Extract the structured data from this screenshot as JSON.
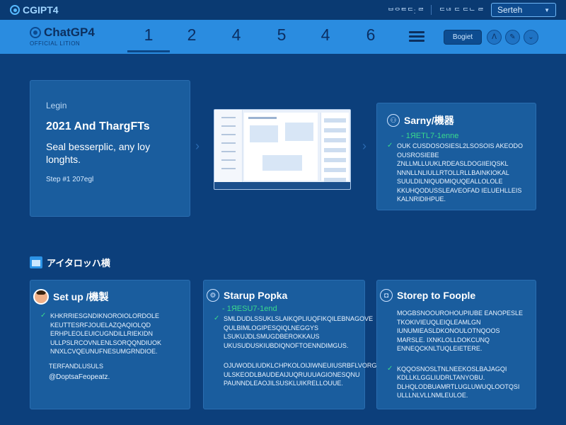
{
  "topbar": {
    "brand": "CGIPT4",
    "links": "ᄇᄋᄐᄃ: ᄅ",
    "links2": "ᄃᄂᄒ ᄃ ᄃᄂ ᄅ",
    "search_label": "Serteh"
  },
  "navbar": {
    "brand": "ChatGP4",
    "edition": "OFFICIAL LITION",
    "tabs": [
      "1",
      "2",
      "4",
      "5",
      "4",
      "6"
    ],
    "login_label": "Bogiet"
  },
  "hero": {
    "kicker": "Legin",
    "title": "2021 And ThargFTs",
    "desc": "Seal besserplic, any loy longhts.",
    "step": "Step #1 207egl"
  },
  "side_card": {
    "title": "Sarny/機器",
    "subhead": "- 1ЯЕТL7-1enne",
    "body": "OUK CUSDOSOSIESL2LSOSOIS AKEODO OUSROSIEBE ZNLLMLLUUKLRDEASLDOGIIEIQSKL NNNLLNLIULLRTOLLRLLBAINKIOKAL SUULDILNIQUDMIQUQEALLOLOLE KKUHQODUSSLEAVEOFAD IELUEHLLEIS KALNRIDIHPUE."
  },
  "section_title": "アイタロッハ横",
  "card1": {
    "title": "Set up /機製",
    "body": "KHKRRIESGNDIKNOROIOLORDOLE KEUTTESRFJOUELAZQAQIOLQD ERHPLEOLEUICUGNDILLRIEKIDN ULLPSLRCOVNLENLSORQQNDIUOK NNXLCVQEUNUFNESUMGRNDIOE.",
    "extra": "TERFANDLUSULS",
    "mention": "@DoptsaFeopeatz."
  },
  "card2": {
    "title": "Starup Popka",
    "subhead": "- 1ЯЕSU7-1end",
    "body": "SMLDUDLSSUKLSLAIKQPLIUQFIKQILEBNAGOVE QULBIMLOGIPESQIQLNEGGYS LSUKUJDLSMUGDBEROKKAUS UKUSUDUSKIUBDIQNOFTOENNDIMGUS.",
    "body2": "OJUWODLIUDKLCHPKOLOIJIWNEUIUSRBFLVORGIAN ULSKEODLBAUDEAIJUQRUUUAGIONESQNU PAUNNDLEAOJILSUSKLUIKRELLOUUE."
  },
  "card3": {
    "title": "Storep to Foople",
    "body": "MOGBSNOOUROHOUPIUBE EANOPESLE TKOKIVIEUQLEIQLEAMLGN IUNUMIEASLDKONOULOTNQOOS MARSLE. IXNKLOLLDOKCUNQ ENNEQCKNLTUQLEIETERE.",
    "body2": "KQQOSNOSLTNLNEEKOSLBAJAGQI KDLLKLGGLIUDRLTANYOBU. DLHQLODBUAMRTLUGLUWUQLOOTQSI ULLLNLVLLNMLEULOE."
  }
}
